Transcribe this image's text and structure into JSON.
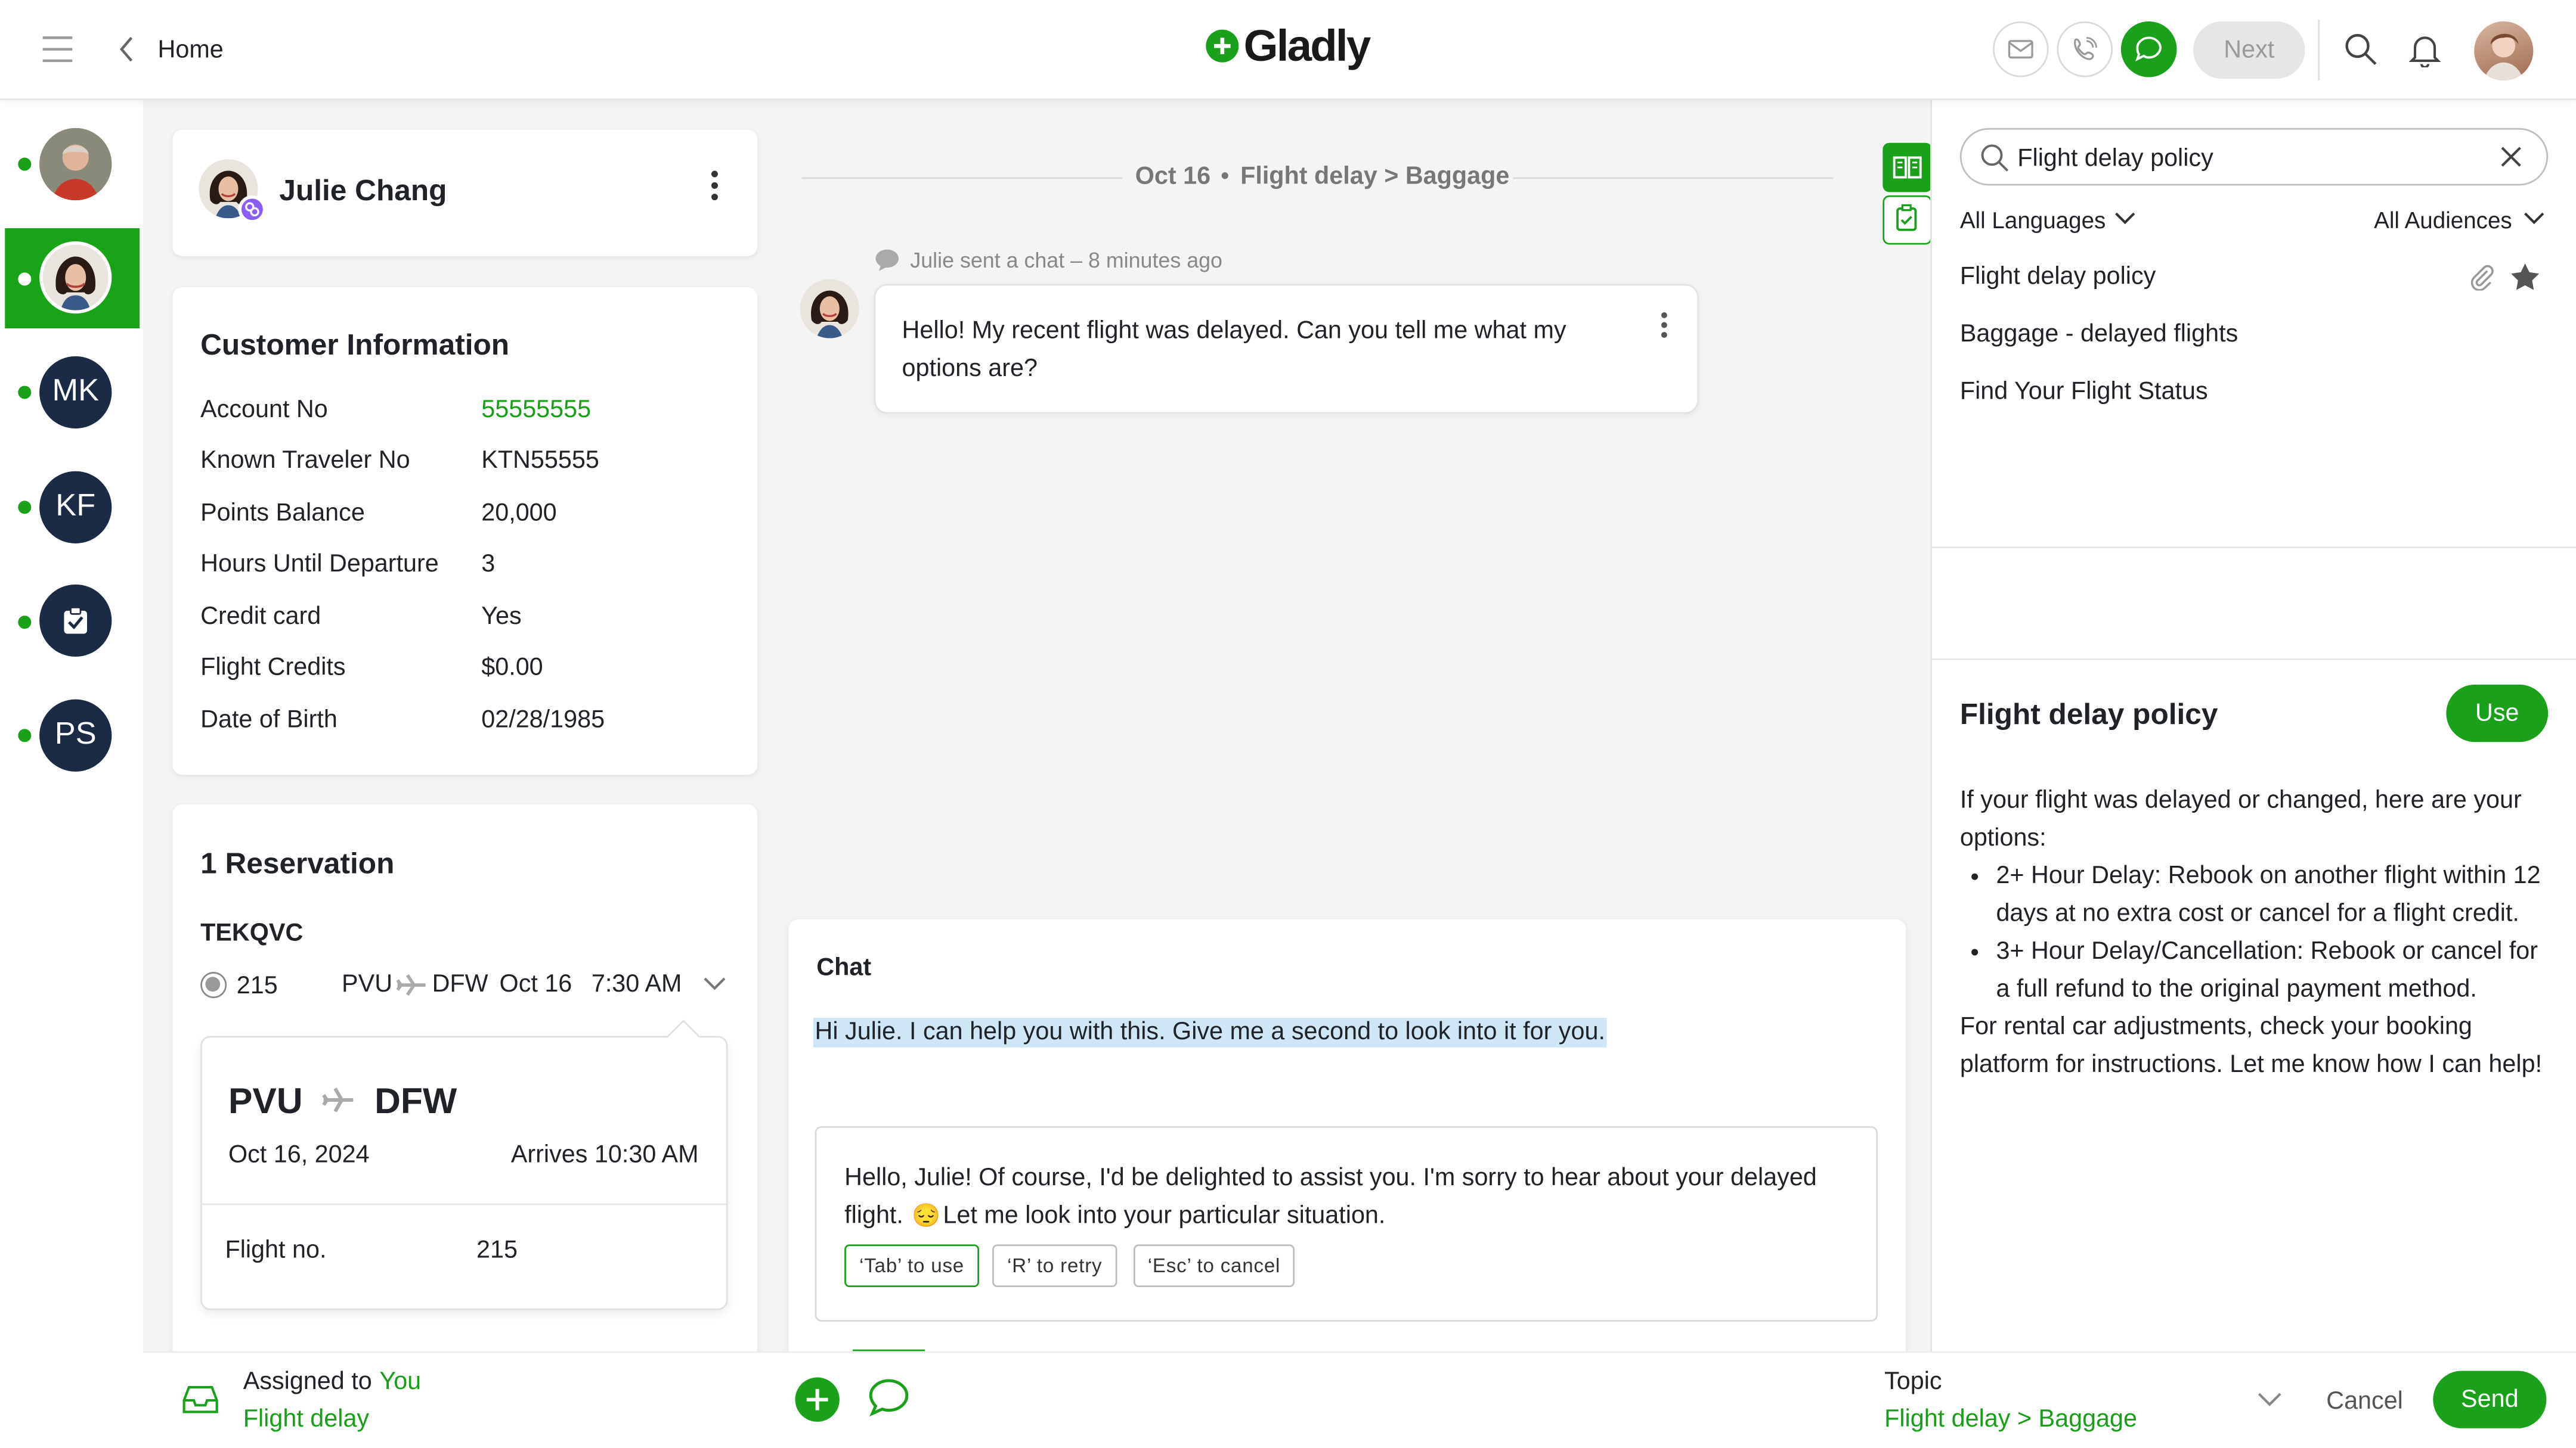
{
  "header": {
    "back_label": "Home",
    "logo": "Gladly",
    "next_label": "Next"
  },
  "rail": {
    "contacts": [
      {
        "initials": ""
      },
      {
        "initials": ""
      },
      {
        "initials": "MK"
      },
      {
        "initials": "KF"
      },
      {
        "initials": ""
      },
      {
        "initials": "PS"
      }
    ]
  },
  "customer": {
    "name": "Julie Chang"
  },
  "customer_info": {
    "title": "Customer Information",
    "fields": [
      {
        "label": "Account No",
        "value": "55555555"
      },
      {
        "label": "Known Traveler No",
        "value": "KTN55555"
      },
      {
        "label": "Points Balance",
        "value": "20,000"
      },
      {
        "label": "Hours Until Departure",
        "value": "3"
      },
      {
        "label": "Credit card",
        "value": "Yes"
      },
      {
        "label": "Flight Credits",
        "value": "$0.00"
      },
      {
        "label": "Date of Birth",
        "value": "02/28/1985"
      }
    ]
  },
  "reservation": {
    "title": "1 Reservation",
    "code": "TEKQVC",
    "flight_no": "215",
    "from": "PVU",
    "to": "DFW",
    "date_short": "Oct 16",
    "time": "7:30 AM",
    "detail": {
      "from": "PVU",
      "to": "DFW",
      "date": "Oct 16, 2024",
      "arrives": "Arrives 10:30 AM",
      "flight_label": "Flight no.",
      "flight_value": "215"
    }
  },
  "conversation": {
    "date": "Oct 16",
    "topic": "Flight delay > Baggage",
    "meta": "Julie sent a chat – 8 minutes ago",
    "message_line1": "Hello! My recent flight was delayed. Can you tell me what my",
    "message_line2": "options are?"
  },
  "composer": {
    "channel": "Chat",
    "draft": "Hi Julie. I can help you with this. Give me a second to look into it for you.",
    "suggestion_line1": "Hello, Julie! Of course, I'd be delighted to assist you. I'm sorry to hear about your delayed",
    "suggestion_line2a": "flight.",
    "suggestion_line2b": "Let me look into your particular situation.",
    "emoji": "😔",
    "buttons": {
      "use": "‘Tab’ to use",
      "retry": "‘R’ to retry",
      "cancel": "‘Esc’ to cancel"
    }
  },
  "knowledge": {
    "search_value": "Flight delay policy",
    "languages": "All Languages",
    "audiences": "All Audiences",
    "results": [
      "Flight delay policy",
      "Baggage - delayed flights",
      "Find Your Flight Status"
    ],
    "article_title": "Flight delay policy",
    "use_label": "Use",
    "intro": "If your flight was delayed or changed, here are your options:",
    "bullets": [
      "2+ Hour Delay: Rebook on another flight within 12 days at no extra cost or cancel for a flight credit.",
      "3+ Hour Delay/Cancellation: Rebook or cancel for a full refund to the original payment method."
    ],
    "outro": "For rental car adjustments, check your booking platform for instructions. Let me know how I can help!"
  },
  "footer": {
    "assigned_prefix": "Assigned to",
    "assignee": "You",
    "inbox": "Flight delay",
    "topic_label": "Topic",
    "topic_value": "Flight delay > Baggage",
    "cancel_label": "Cancel",
    "send_label": "Send"
  },
  "colors": {
    "brand": "#1aa01a",
    "rail_avatar": "#1b2a45"
  }
}
